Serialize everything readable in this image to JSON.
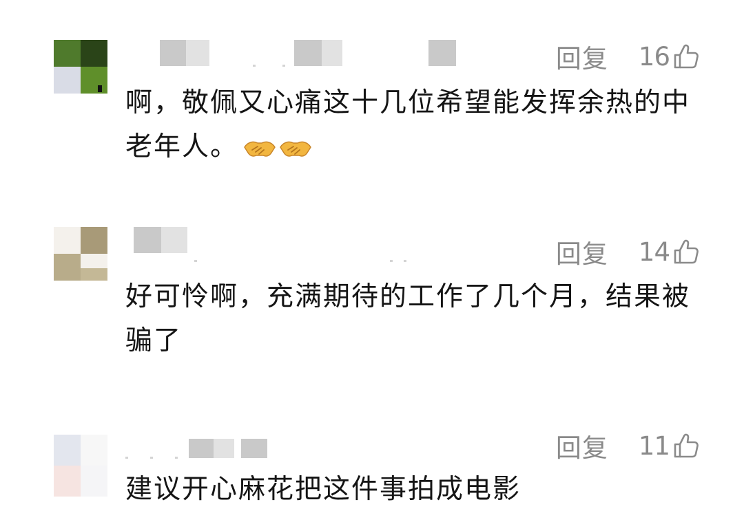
{
  "comments": [
    {
      "text": "啊，敬佩又心痛这十几位希望能发挥余热的中老年人。",
      "emoji": "handshake",
      "reply_label": "回复",
      "like_count": "16",
      "avatar_colors": [
        "#4f7a2c",
        "#2a4418",
        "#d9dce6",
        "#5f8f2a"
      ]
    },
    {
      "text": "好可怜啊，充满期待的工作了几个月，结果被骗了",
      "reply_label": "回复",
      "like_count": "14",
      "avatar_colors": [
        "#f4f1ec",
        "#a89a78",
        "#bdb18f",
        "#c6bb95"
      ]
    },
    {
      "text": "建议开心麻花把这件事拍成电影",
      "reply_label": "回复",
      "like_count": "11",
      "avatar_colors": [
        "#f5f5f7",
        "#f7f7f7",
        "#e3e6ee",
        "#f6e4e1"
      ]
    }
  ],
  "icons": {
    "like": "thumbs-up-outline-icon",
    "emoji": "handshake-emoji-icon"
  },
  "colors": {
    "text": "#151515",
    "meta": "#8a8a8a",
    "emoji": "#f2b640"
  }
}
